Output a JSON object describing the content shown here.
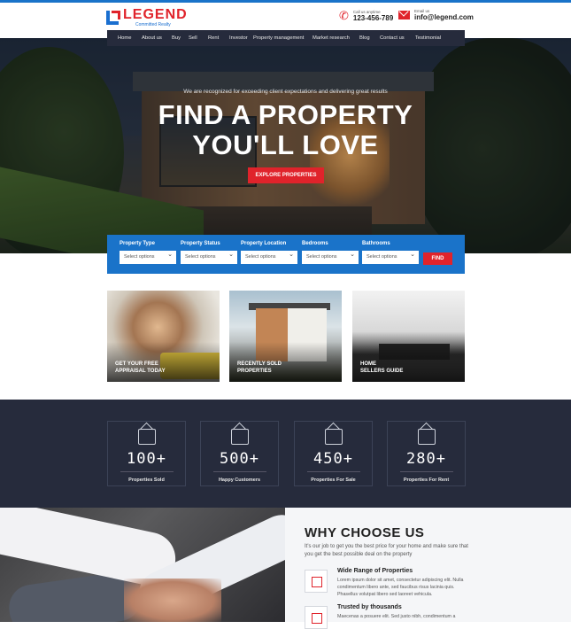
{
  "brand": {
    "name": "LEGEND",
    "tagline": "Committed Realty"
  },
  "contact": {
    "phone_label": "Call us anytime",
    "phone": "123-456-789",
    "email_label": "Email us",
    "email": "info@legend.com"
  },
  "nav": [
    "Home",
    "About us",
    "Buy",
    "Sell",
    "Rent",
    "Investor",
    "Property management",
    "Market research",
    "Blog",
    "Contact us",
    "Testimonial"
  ],
  "hero": {
    "tagline": "We are recognized for exceeding client expectations and delivering great results",
    "title_line1": "FIND A PROPERTY",
    "title_line2": "YOU'LL LOVE",
    "cta": "EXPLORE PROPERTIES"
  },
  "search": {
    "fields": [
      {
        "label": "Property Type",
        "value": "Select options"
      },
      {
        "label": "Property Status",
        "value": "Select options"
      },
      {
        "label": "Property Location",
        "value": "Select options"
      },
      {
        "label": "Bedrooms",
        "value": "Select options"
      },
      {
        "label": "Bathrooms",
        "value": "Select options"
      }
    ],
    "button": "FIND"
  },
  "cards": [
    {
      "line1": "GET YOUR FREE",
      "line2": "APPRAISAL TODAY"
    },
    {
      "line1": "RECENTLY SOLD",
      "line2": "PROPERTIES"
    },
    {
      "line1": "HOME",
      "line2": "SELLERS GUIDE"
    }
  ],
  "stats": [
    {
      "value": "100+",
      "label": "Properties Sold",
      "icon": "house-icon"
    },
    {
      "value": "500+",
      "label": "Happy Customers",
      "icon": "customers-icon"
    },
    {
      "value": "450+",
      "label": "Properties For Sale",
      "icon": "sale-sign-icon"
    },
    {
      "value": "280+",
      "label": "Properties For Rent",
      "icon": "rent-house-icon"
    }
  ],
  "why": {
    "title": "WHY CHOOSE US",
    "intro": "It's our job to get you the best price for your home and make sure that you get the best possible deal on the property",
    "features": [
      {
        "title": "Wide Range of Properties",
        "text": "Lorem ipsum dolor sit amet, consectetur adipiscing elit. Nulla condimentum libero ante, sed faucibus risus lacinia quis. Phasellus volutpat libero sed laoreet vehicula."
      },
      {
        "title": "Trusted by thousands",
        "text": "Maecenas a posuere elit. Sed justo nibh, condimentum a"
      }
    ]
  },
  "colors": {
    "accent": "#e0232b",
    "primary": "#1a73c9",
    "dark": "#262b3c"
  }
}
